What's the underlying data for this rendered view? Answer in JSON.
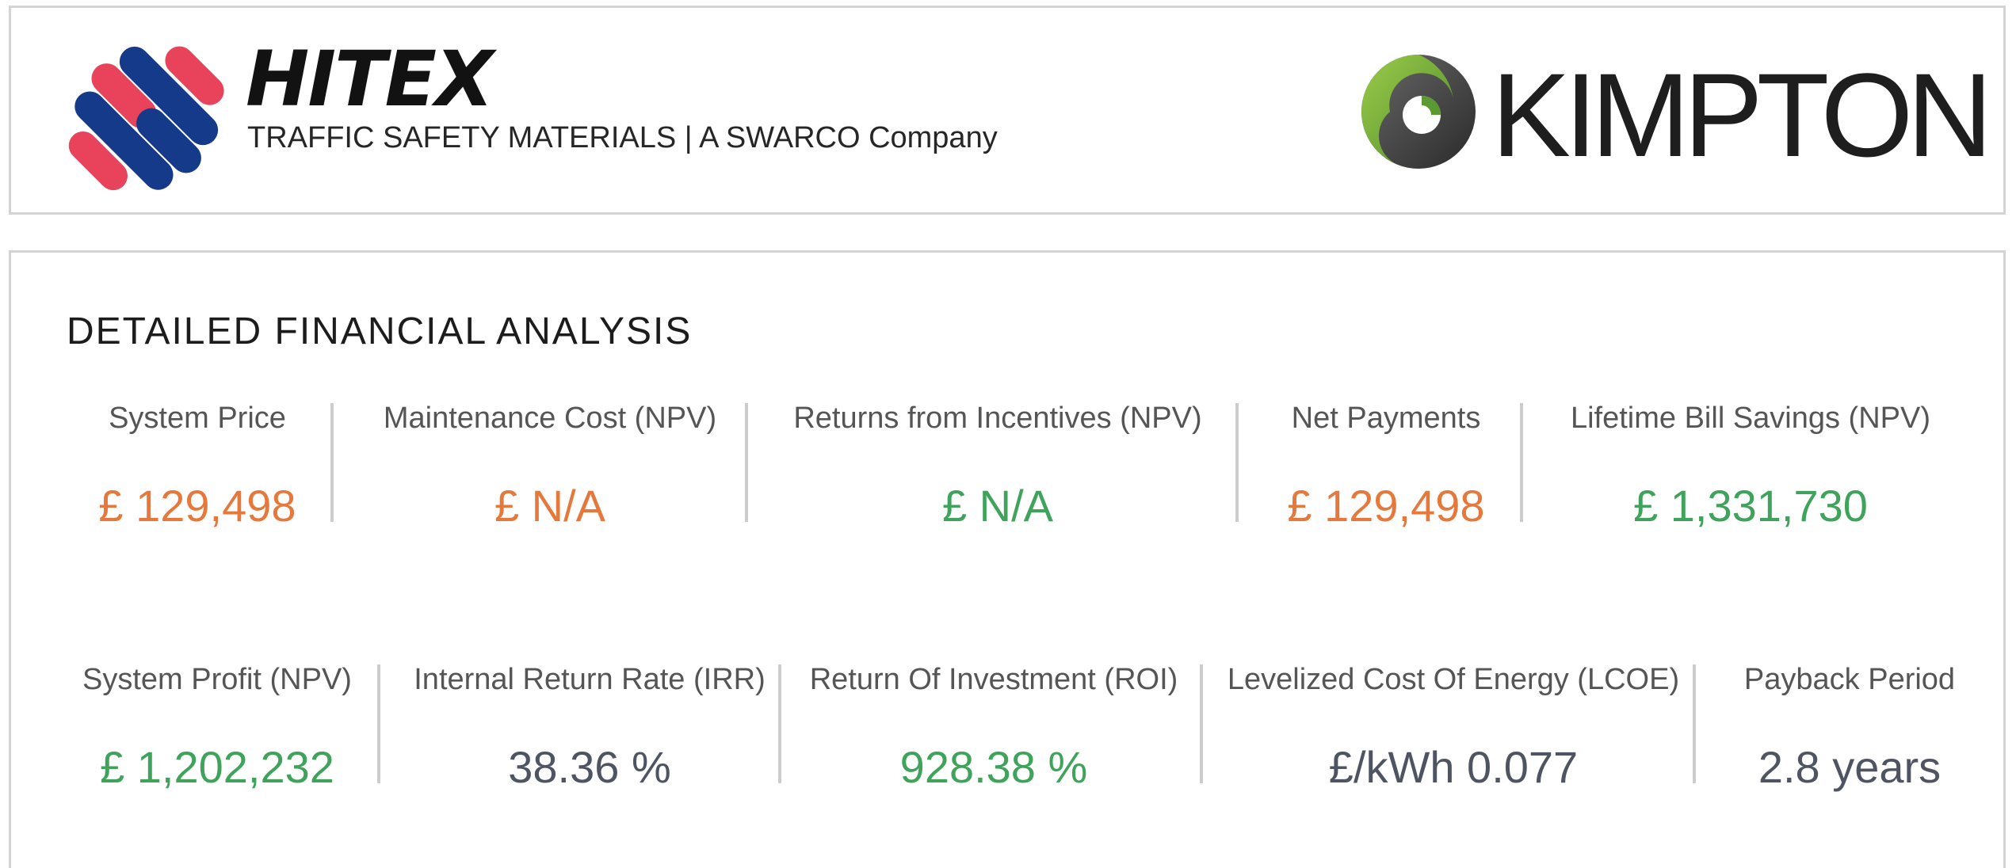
{
  "header": {
    "brand_name": "HITEX",
    "brand_tagline": "TRAFFIC SAFETY MATERIALS | A SWARCO Company",
    "partner_name": "KIMPTON"
  },
  "analysis": {
    "title": "DETAILED FINANCIAL ANALYSIS",
    "row1": [
      {
        "label": "System Price",
        "value": "£ 129,498",
        "color": "#e5793c"
      },
      {
        "label": "Maintenance Cost (NPV)",
        "value": "£ N/A",
        "color": "#e5793c"
      },
      {
        "label": "Returns from Incentives (NPV)",
        "value": "£ N/A",
        "color": "#3fa35b"
      },
      {
        "label": "Net Payments",
        "value": "£ 129,498",
        "color": "#e5793c"
      },
      {
        "label": "Lifetime Bill Savings (NPV)",
        "value": "£ 1,331,730",
        "color": "#3fa35b"
      }
    ],
    "row2": [
      {
        "label": "System Profit (NPV)",
        "value": "£ 1,202,232",
        "color": "#3fa35b"
      },
      {
        "label": "Internal Return Rate (IRR)",
        "value": "38.36 %",
        "color": "#4f5462"
      },
      {
        "label": "Return Of Investment (ROI)",
        "value": "928.38 %",
        "color": "#3fa35b"
      },
      {
        "label": "Levelized Cost Of Energy (LCOE)",
        "value": "£/kWh 0.077",
        "color": "#4f5462"
      },
      {
        "label": "Payback Period",
        "value": "2.8 years",
        "color": "#4f5462"
      }
    ]
  },
  "colors": {
    "hitex_red": "#e8435a",
    "hitex_blue": "#163a8a",
    "kimpton_green": "#7cb342",
    "kimpton_dark": "#3a3a3a"
  }
}
